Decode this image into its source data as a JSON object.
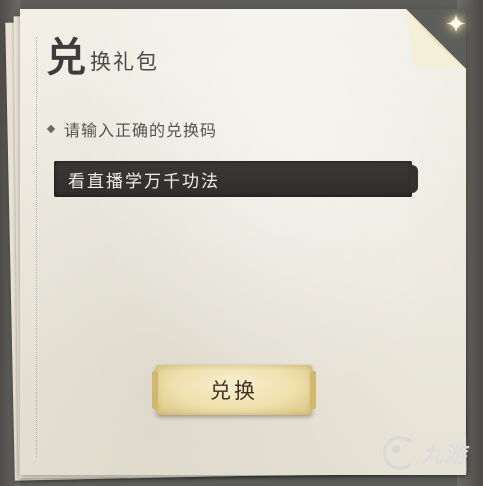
{
  "title": {
    "first_char": "兑",
    "rest": "换礼包"
  },
  "instruction": {
    "text": "请输入正确的兑换码"
  },
  "code_input": {
    "value": "看直播学万千功法"
  },
  "redeem_button": {
    "label": "兑换"
  },
  "watermark": {
    "text": "九游",
    "icon": "jiuyou-logo-icon"
  },
  "decorations": {
    "sparkle_icon": "sparkle-icon",
    "bullet_icon": "diamond-bullet-icon"
  },
  "colors": {
    "paper": "#ece9de",
    "input_bg": "#32302e",
    "button_gold": "#efe0ad",
    "text_dark": "#3c3c3c"
  }
}
